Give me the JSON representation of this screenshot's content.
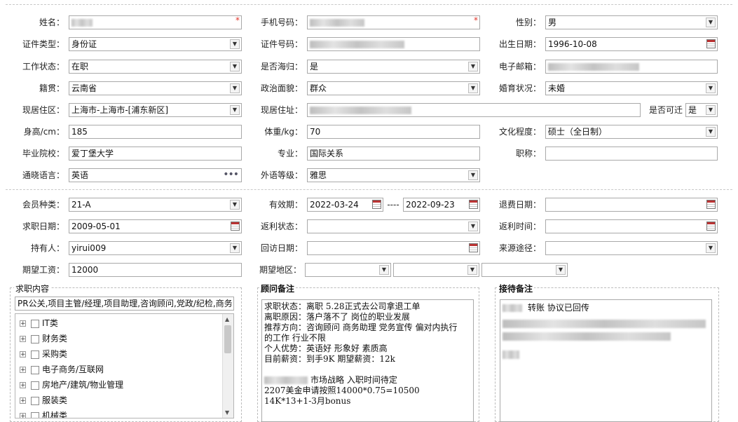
{
  "personal": {
    "name": {
      "label": "姓名：",
      "value": ""
    },
    "mobile": {
      "label": "手机号码：",
      "value": ""
    },
    "gender": {
      "label": "性别：",
      "value": "男"
    },
    "id_type": {
      "label": "证件类型：",
      "value": "身份证"
    },
    "id_number": {
      "label": "证件号码：",
      "value": ""
    },
    "birth_date": {
      "label": "出生日期：",
      "value": "1996-10-08"
    },
    "work_status": {
      "label": "工作状态：",
      "value": "在职"
    },
    "overseas_returnee": {
      "label": "是否海归：",
      "value": "是"
    },
    "email": {
      "label": "电子邮箱：",
      "value": ""
    },
    "native_place": {
      "label": "籍贯：",
      "value": "云南省"
    },
    "political_status": {
      "label": "政治面貌：",
      "value": "群众"
    },
    "marital_status": {
      "label": "婚育状况：",
      "value": "未婚"
    },
    "current_region": {
      "label": "现居住区：",
      "value": "上海市-上海市-[浦东新区]"
    },
    "current_address": {
      "label": "现居住址：",
      "value": ""
    },
    "can_relocate": {
      "label": "是否可迁",
      "value": "是"
    },
    "height": {
      "label": "身高/cm：",
      "value": "185"
    },
    "weight": {
      "label": "体重/kg：",
      "value": "70"
    },
    "education": {
      "label": "文化程度：",
      "value": "硕士（全日制）"
    },
    "school": {
      "label": "毕业院校：",
      "value": "爱丁堡大学"
    },
    "major": {
      "label": "专业：",
      "value": "国际关系"
    },
    "title": {
      "label": "职称：",
      "value": ""
    },
    "languages": {
      "label": "通晓语言：",
      "value": "英语",
      "more": "•••"
    },
    "language_level": {
      "label": "外语等级：",
      "value": "雅思"
    }
  },
  "membership": {
    "member_type": {
      "label": "会员种类：",
      "value": "21-A"
    },
    "validity": {
      "label": "有效期：",
      "start": "2022-03-24",
      "sep": "----",
      "end": "2022-09-23"
    },
    "refund_date": {
      "label": "退费日期：",
      "value": ""
    },
    "job_seek_date": {
      "label": "求职日期：",
      "value": "2009-05-01"
    },
    "rebate_status": {
      "label": "返利状态：",
      "value": ""
    },
    "rebate_time": {
      "label": "返利时间：",
      "value": ""
    },
    "holder": {
      "label": "持有人：",
      "value": "yirui009"
    },
    "revisit_date": {
      "label": "回访日期：",
      "value": ""
    },
    "source": {
      "label": "来源途径：",
      "value": ""
    },
    "expected_salary": {
      "label": "期望工资：",
      "value": "12000"
    },
    "expected_region": {
      "label": "期望地区：",
      "values": [
        "",
        "",
        ""
      ]
    }
  },
  "job_content": {
    "title": "求职内容",
    "selected_text": "PR公关,项目主管/经理,项目助理,咨询顾问,党政/纪检,商务",
    "tree": [
      "IT类",
      "财务类",
      "采购类",
      "电子商务/互联网",
      "房地产/建筑/物业管理",
      "服装类",
      "机械类"
    ]
  },
  "consultant_notes": {
    "title": "顾问备注",
    "lines": [
      "求职状态：离职 5.28正式去公司拿退工单",
      "离职原因：落户落不了  岗位的职业发展",
      "推荐方向：咨询顾问 商务助理 党务宣传  偏对内执行",
      "的工作 行业不限",
      "个人优势：英语好  形象好 素质高",
      "目前薪资：到手9K   期望薪资：12k",
      "",
      "市场战略   入职时间待定",
      "2207美金申请按照14000*0.75=10500",
      "14K*13+1-3月bonus"
    ]
  },
  "reception_notes": {
    "title": "接待备注",
    "first_line": "转账  协议已回传"
  },
  "colors": {
    "required": "#e0342a",
    "border": "#a9a9a9",
    "divider": "#c8c8c8"
  }
}
